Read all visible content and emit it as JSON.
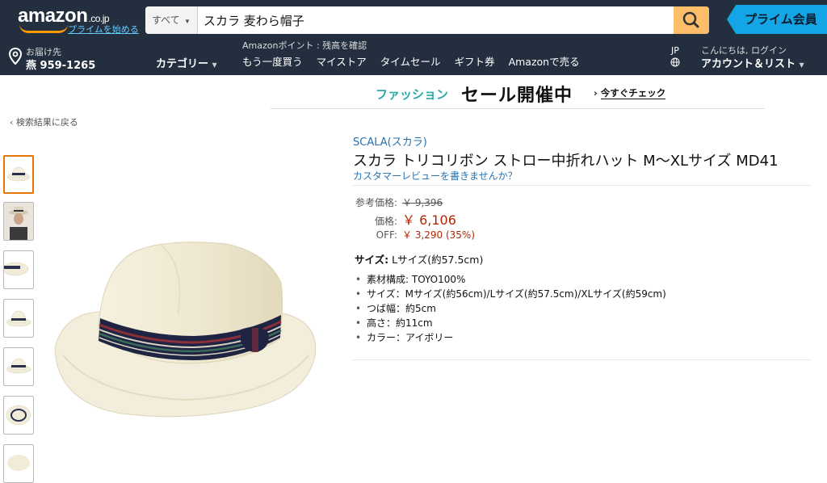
{
  "header": {
    "logo": "amazon",
    "logo_suffix": ".co.jp",
    "prime_link": "プライムを始める",
    "search_category": "すべて",
    "search_query": "スカラ 麦わら帽子",
    "prime_banner": "プライム会員",
    "deliver_line1": "お届け先",
    "deliver_line2": "燕 959-1265",
    "categories": "カテゴリー",
    "points": "Amazonポイント : 残高を確認",
    "nav_links": [
      "もう一度買う",
      "マイストア",
      "タイムセール",
      "ギフト券",
      "Amazonで売る"
    ],
    "language": "JP",
    "greeting": "こんにちは, ログイン",
    "account": "アカウント＆リスト"
  },
  "promo": {
    "fashion": "ファッション",
    "sale": "セール開催中",
    "check": "今すぐチェック"
  },
  "back_link": "検索結果に戻る",
  "product": {
    "brand": "SCALA(スカラ)",
    "title": "スカラ トリコリボン ストロー中折れハット M～XLサイズ MD41",
    "review_link": "カスタマーレビューを書きませんか？",
    "list_price_label": "参考価格:",
    "list_price": "￥ 9,396",
    "price_label": "価格:",
    "price": "￥ 6,106",
    "off_label": "OFF:",
    "off": "￥ 3,290 (35%)",
    "size_label": "サイズ:",
    "size_value": "Lサイズ(約57.5cm)",
    "bullets": [
      "素材構成: TOYO100%",
      "サイズ：Mサイズ(約56cm)/Lサイズ(約57.5cm)/XLサイズ(約59cm)",
      "つば幅：約5cm",
      "高さ：約11cm",
      "カラー：アイボリー"
    ]
  },
  "colors": {
    "nav_bg": "#232f3e",
    "search_button": "#febd69",
    "link": "#2673b4",
    "price": "#b12704",
    "promo_accent": "#2ba9a7",
    "thumb_selected": "#e77600"
  }
}
